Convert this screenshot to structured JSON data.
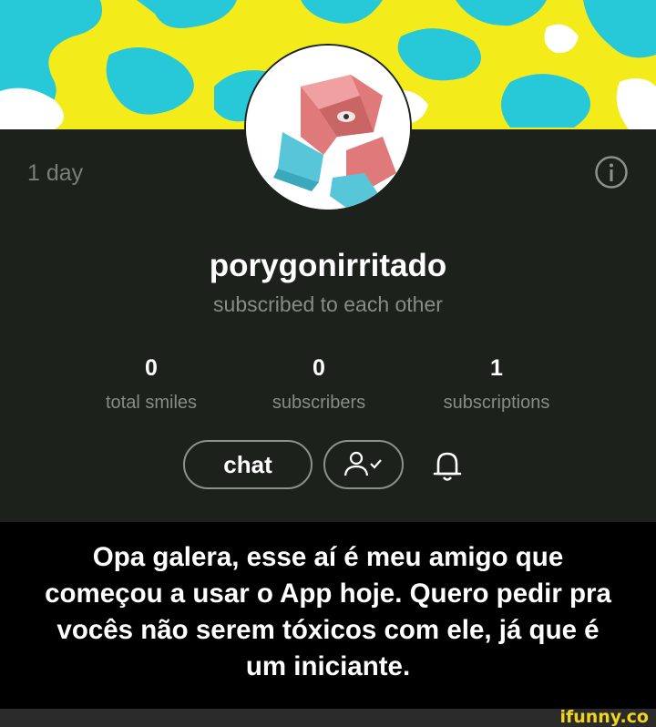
{
  "profile": {
    "account_age": "1 day",
    "username": "porygonirritado",
    "relation": "subscribed to each other",
    "stats": [
      {
        "value": "0",
        "label": "total smiles"
      },
      {
        "value": "0",
        "label": "subscribers"
      },
      {
        "value": "1",
        "label": "subscriptions"
      }
    ],
    "chat_label": "chat",
    "icons": [
      "info-icon",
      "subscribed-user-icon",
      "bell-icon"
    ]
  },
  "caption": {
    "lines": [
      "Opa galera, esse aí é meu amigo que",
      "começou a usar o App hoje. Quero pedir pra",
      "vocês não serem tóxicos com ele, já que é",
      "um iniciante."
    ]
  },
  "watermark": "ifunny.co",
  "colors": {
    "banner_yellow": "#f4ec1a",
    "banner_cyan": "#27c8d8",
    "profile_bg": "#1c221b",
    "watermark": "#f1d322"
  }
}
